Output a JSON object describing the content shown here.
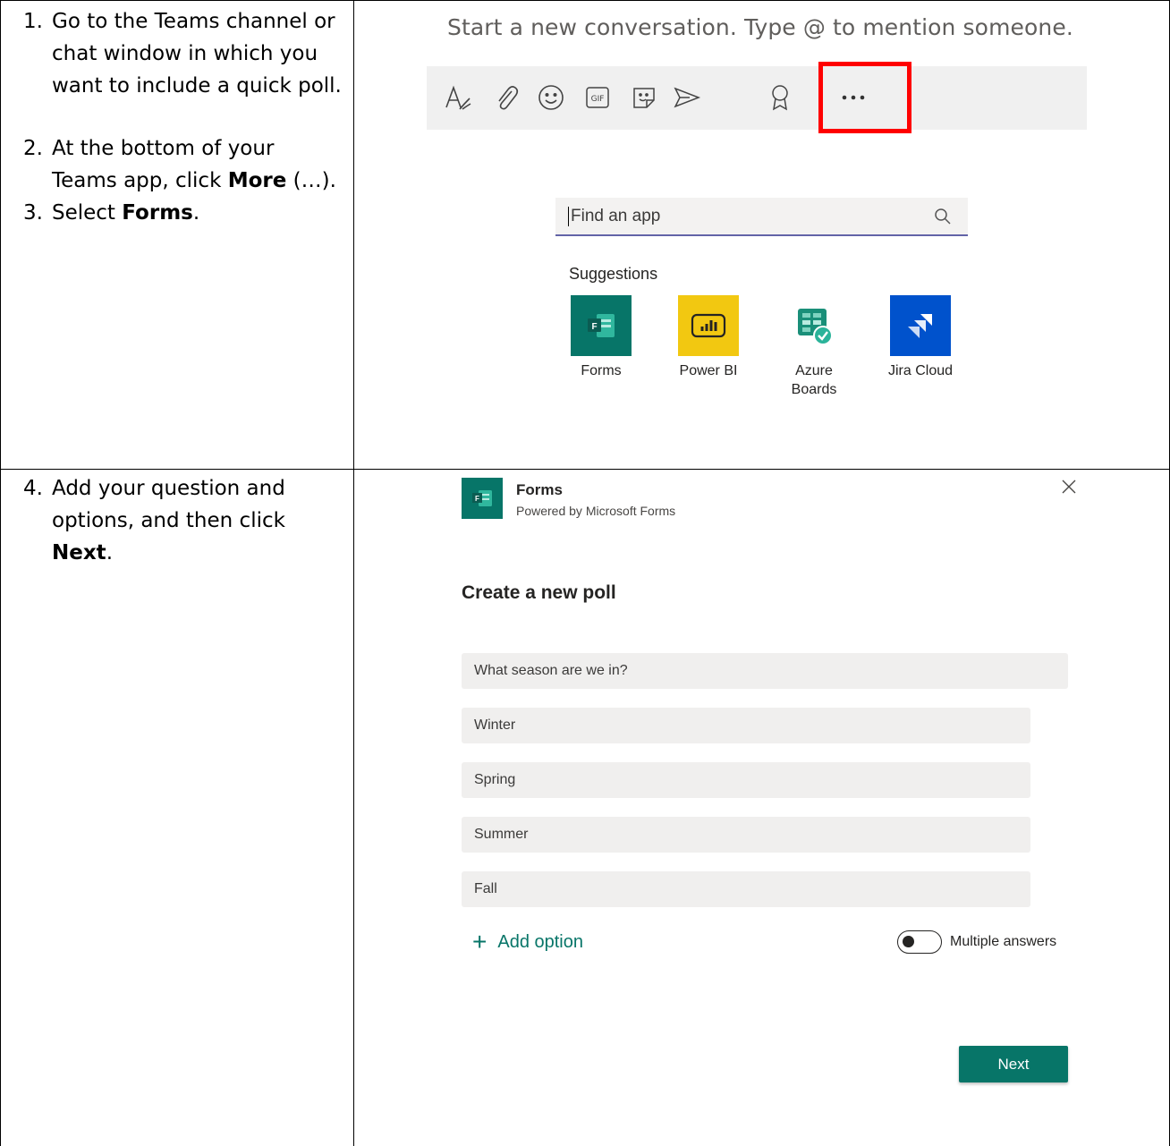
{
  "steps_top": [
    {
      "num": "1.",
      "text": "Go to the Teams channel or chat window in which you want to include a quick poll."
    },
    {
      "num": "2.",
      "text_before": "At the bottom of your Teams app, click ",
      "bold": "More",
      "text_after": " (…)."
    },
    {
      "num": "3.",
      "text_before": "Select ",
      "bold": "Forms",
      "text_after": "."
    }
  ],
  "steps_bottom": [
    {
      "num": "4.",
      "text_before": "Add your question and options, and then click ",
      "bold": "Next",
      "text_after": "."
    }
  ],
  "compose": {
    "prompt": "Start a new conversation. Type @ to mention someone.",
    "toolbar_icons": [
      "format-icon",
      "attach-icon",
      "emoji-icon",
      "gif-icon",
      "sticker-icon",
      "meet-now-icon",
      "praise-icon",
      "more-icon"
    ],
    "highlight_color": "#ff0000"
  },
  "app_search": {
    "placeholder": "Find an app",
    "suggestions_label": "Suggestions",
    "apps": [
      {
        "name": "Forms",
        "color": "#077568"
      },
      {
        "name": "Power BI",
        "color": "#f2c811"
      },
      {
        "name": "Azure Boards",
        "color": "#ffffff"
      },
      {
        "name": "Jira Cloud",
        "color": "#0052cc"
      }
    ]
  },
  "forms_dialog": {
    "app_name": "Forms",
    "subtitle": "Powered by Microsoft Forms",
    "heading": "Create a new poll",
    "question": "What season are we in?",
    "options": [
      "Winter",
      "Spring",
      "Summer",
      "Fall"
    ],
    "add_option": "Add option",
    "multiple_answers": "Multiple answers",
    "next": "Next",
    "accent": "#077568"
  }
}
